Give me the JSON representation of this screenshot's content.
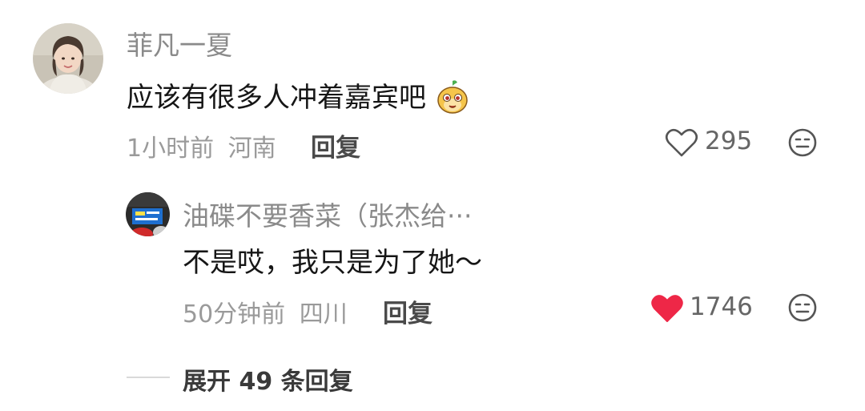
{
  "comment": {
    "username": "菲凡一夏",
    "text": "应该有很多人冲着嘉宾吧",
    "emoji_icon": "cute-smiling-creature-emoji",
    "time": "1小时前",
    "location": "河南",
    "reply_label": "回复",
    "like_count": "295",
    "liked": false
  },
  "reply": {
    "username": "油碟不要香菜（张杰给···",
    "text": "不是哎，我只是为了她～",
    "time": "50分钟前",
    "location": "四川",
    "reply_label": "回复",
    "like_count": "1746",
    "liked": true
  },
  "expand": {
    "label": "展开 49 条回复"
  },
  "colors": {
    "like_active": "#ee2747",
    "muted_text": "#9a9a9a",
    "name_text": "#8a8a8a"
  },
  "icons": {
    "like": "heart-outline-icon",
    "like_active": "heart-filled-icon",
    "dislike": "neutral-face-icon"
  }
}
